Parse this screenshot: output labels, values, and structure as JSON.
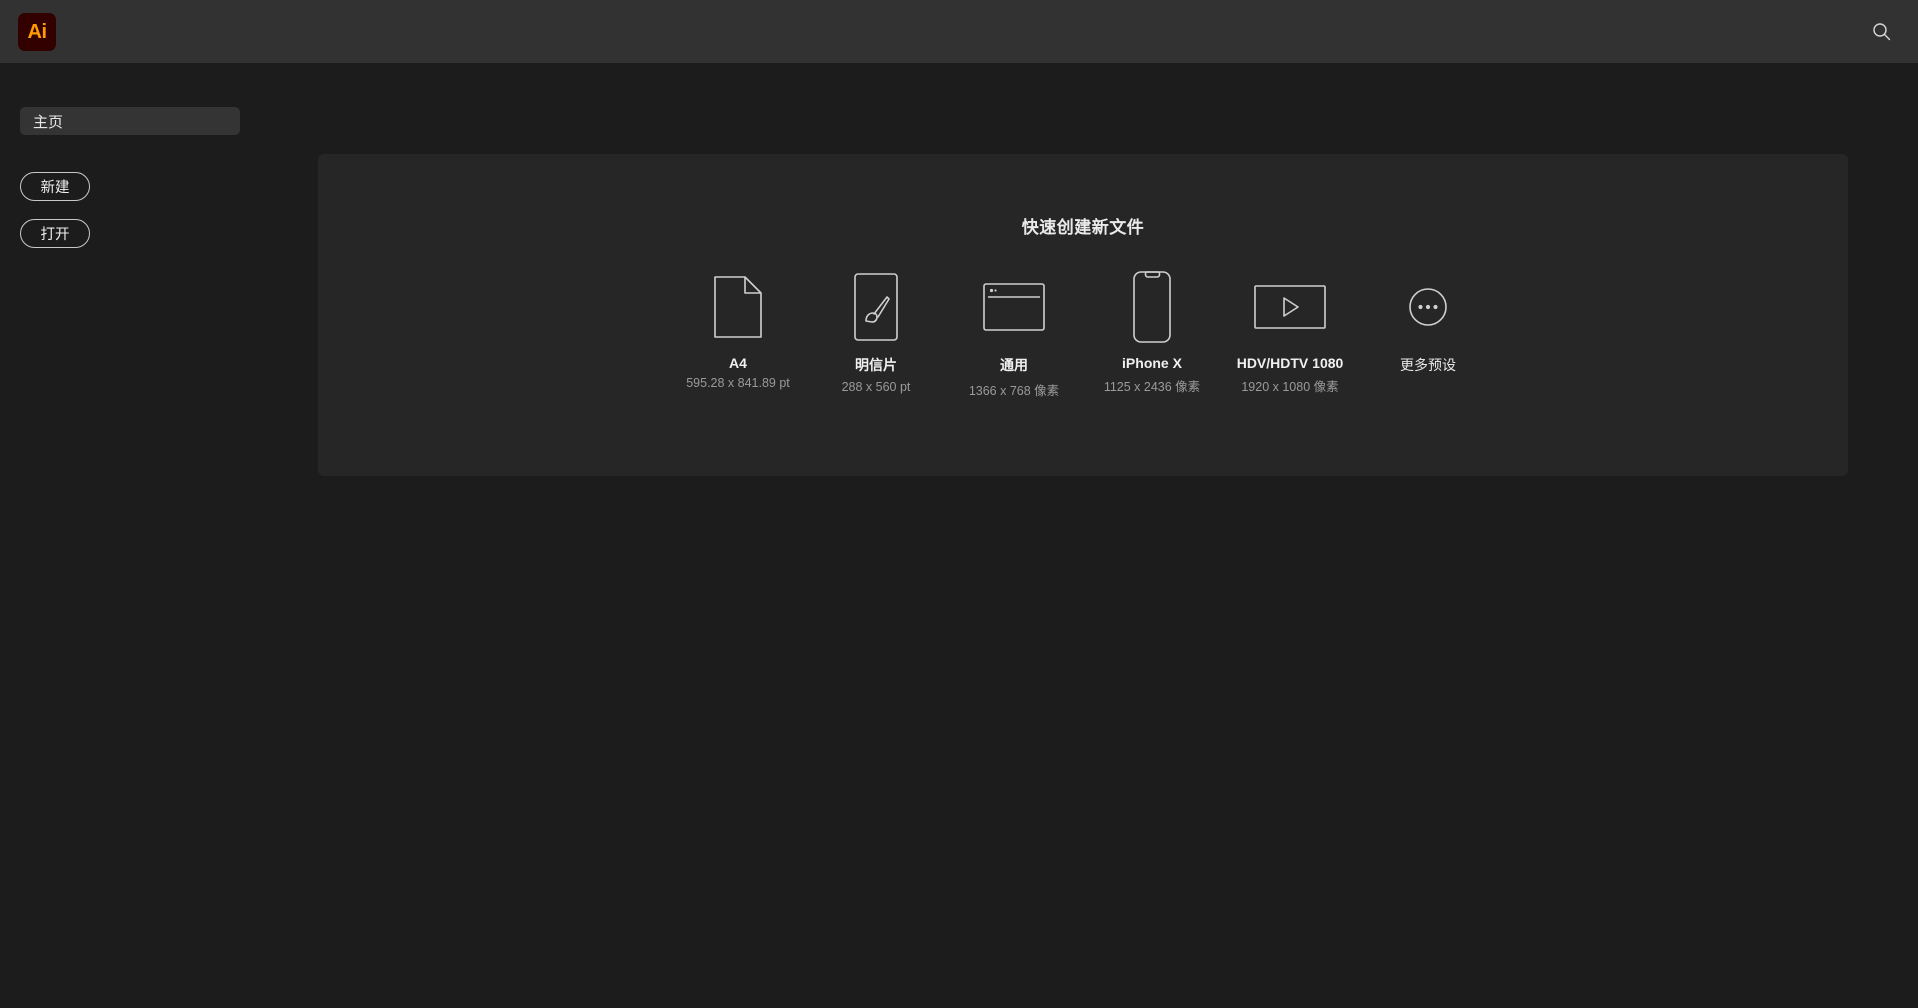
{
  "app": {
    "logo_text": "Ai",
    "logo_bg": "#330000",
    "logo_fg": "#ff9a00"
  },
  "topbar": {
    "search_icon": "search-icon"
  },
  "sidebar": {
    "items": [
      {
        "label": "主页",
        "selected": true
      }
    ],
    "buttons": [
      {
        "label": "新建",
        "name": "new-button"
      },
      {
        "label": "打开",
        "name": "open-button"
      }
    ]
  },
  "main": {
    "panel_title": "快速创建新文件",
    "presets": [
      {
        "label": "A4",
        "sub": "595.28 x 841.89 pt",
        "icon": "document-page-icon",
        "bold": true
      },
      {
        "label": "明信片",
        "sub": "288 x 560 pt",
        "icon": "paintbrush-card-icon",
        "bold": true
      },
      {
        "label": "通用",
        "sub": "1366 x 768 像素",
        "icon": "browser-window-icon",
        "bold": true
      },
      {
        "label": "iPhone X",
        "sub": "1125 x 2436 像素",
        "icon": "phone-icon",
        "bold": true
      },
      {
        "label": "HDV/HDTV 1080",
        "sub": "1920 x 1080 像素",
        "icon": "video-play-icon",
        "bold": true
      },
      {
        "label": "更多预设",
        "sub": "",
        "icon": "more-ellipsis-icon",
        "bold": false
      }
    ]
  },
  "colors": {
    "topbar": "#323232",
    "page_bg": "#1c1c1c",
    "panel_bg": "#262626",
    "selected_item_bg": "#343434",
    "stroke": "#cfcfcf",
    "sub_text": "#9a9a9a"
  }
}
